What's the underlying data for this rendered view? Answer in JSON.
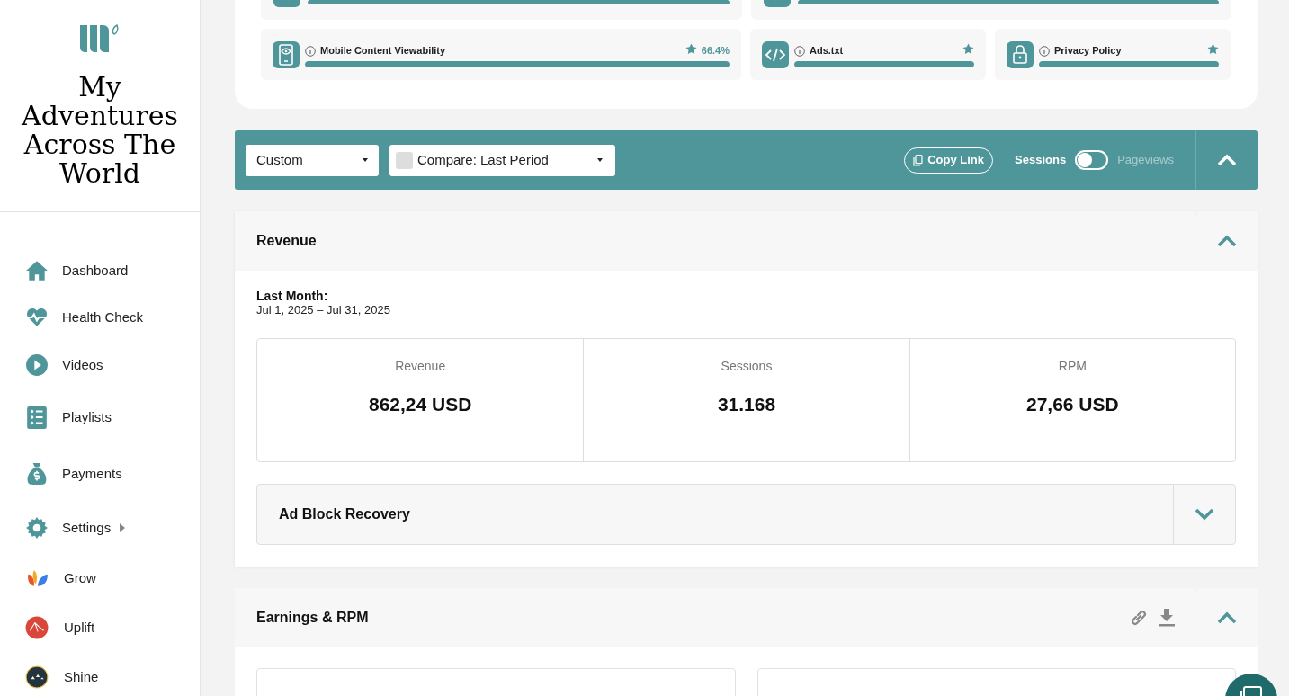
{
  "sidebar": {
    "brand": "My Adventures Across The World",
    "nav": [
      {
        "label": "Dashboard",
        "has_submenu": false
      },
      {
        "label": "Health Check",
        "has_submenu": false
      },
      {
        "label": "Videos",
        "has_submenu": false
      },
      {
        "label": "Playlists",
        "has_submenu": false
      },
      {
        "label": "Payments",
        "has_submenu": false
      },
      {
        "label": "Settings",
        "has_submenu": true
      },
      {
        "label": "Grow",
        "has_submenu": false
      },
      {
        "label": "Uplift",
        "has_submenu": false
      },
      {
        "label": "Shine",
        "has_submenu": false
      }
    ]
  },
  "health_checks": {
    "partial_items": [
      {
        "level": 1
      },
      {
        "level": 1
      }
    ],
    "items": [
      {
        "kind": "mobile",
        "label": "Mobile Content Viewability",
        "starred": true,
        "reading": "66.4%",
        "level": 1
      },
      {
        "kind": "code",
        "label": "Ads.txt",
        "starred": true,
        "level": 1
      },
      {
        "kind": "lock",
        "label": "Privacy Policy",
        "starred": true,
        "level": 1
      }
    ]
  },
  "toolbar": {
    "date_range": "Custom",
    "compare": "Compare: Last Period",
    "compare_checked": false,
    "copy_link": "Copy Link",
    "metric_toggle": [
      {
        "label": "Sessions",
        "selected": true
      },
      {
        "label": "Pageviews",
        "selected": false
      }
    ],
    "expanded": true
  },
  "revenue": {
    "title": "Revenue",
    "expanded": true,
    "period_label": "Last Month:",
    "period_range": "Jul 1, 2025 – Jul 31, 2025",
    "metrics": [
      {
        "label": "Revenue",
        "value": "862,24 USD"
      },
      {
        "label": "Sessions",
        "value": "31.168"
      },
      {
        "label": "RPM",
        "value": "27,66 USD"
      }
    ],
    "ad_block": {
      "title": "Ad Block Recovery",
      "expanded": false
    }
  },
  "earnings": {
    "title": "Earnings & RPM",
    "expanded": true
  }
}
